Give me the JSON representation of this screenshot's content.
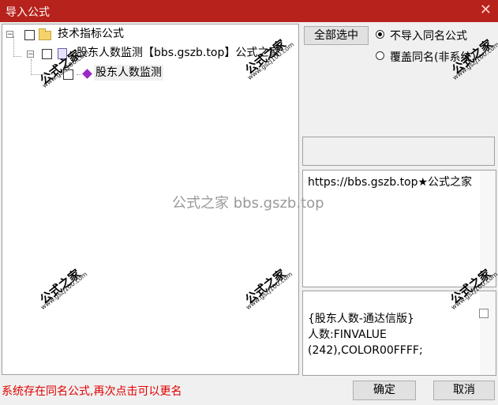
{
  "window": {
    "title": "导入公式"
  },
  "tree": {
    "root": {
      "label": "技术指标公式"
    },
    "group": {
      "label": "股东人数监测【bbs.gszb.top】公式之家"
    },
    "item": {
      "label": "股东人数监测"
    }
  },
  "options": {
    "select_all_label": "全部选中",
    "radio1_label": "不导入同名公式",
    "radio2_label": "覆盖同名(非系统)"
  },
  "description": {
    "text": "https://bbs.gszb.top★公式之家"
  },
  "code": {
    "text": "{股东人数-通达信版}\n人数:FINVALUE\n(242),COLOR00FFFF;"
  },
  "status": {
    "text": "系统存在同名公式,再次点击可以更名"
  },
  "buttons": {
    "ok": "确定",
    "cancel": "取消"
  },
  "watermarks": {
    "logo": "公式之家",
    "url": "www.gszj100.com",
    "center": "公式之家 bbs.gszb.top"
  },
  "colors": {
    "titlebar": "#b7221c",
    "status": "#e00000",
    "tree_diamond": "#9b27c8"
  }
}
